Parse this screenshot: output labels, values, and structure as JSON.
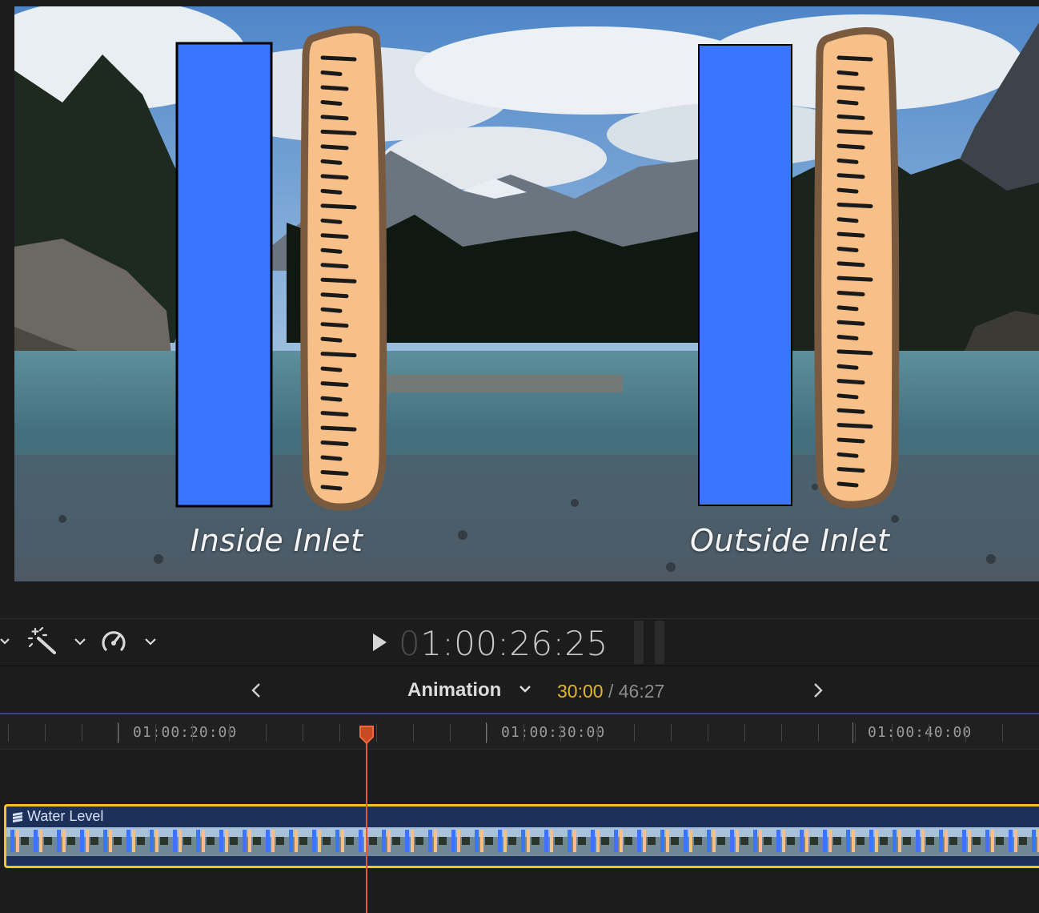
{
  "viewer": {
    "caption_left": "Inside Inlet",
    "caption_right": "Outside Inlet",
    "bar_color": "#3b74ff",
    "ruler_color": "#f8c089"
  },
  "toolbar": {
    "timecode_dim": "0",
    "timecode_main": "1:00:26:25",
    "icons": [
      "chevron-down-icon",
      "magic-wand-icon",
      "speedometer-icon",
      "play-icon"
    ]
  },
  "animation_bar": {
    "title": "Animation",
    "current_time": "30:00",
    "separator": " / ",
    "total_time": "46:27"
  },
  "timeline": {
    "ruler_labels": [
      "01:00:20:00",
      "01:00:30:00",
      "01:00:40:00"
    ],
    "clip_name": "Water Level",
    "accent_colors": {
      "selection": "#f2c523",
      "playhead": "#e8582a",
      "clip_bg": "#1d3059"
    }
  }
}
